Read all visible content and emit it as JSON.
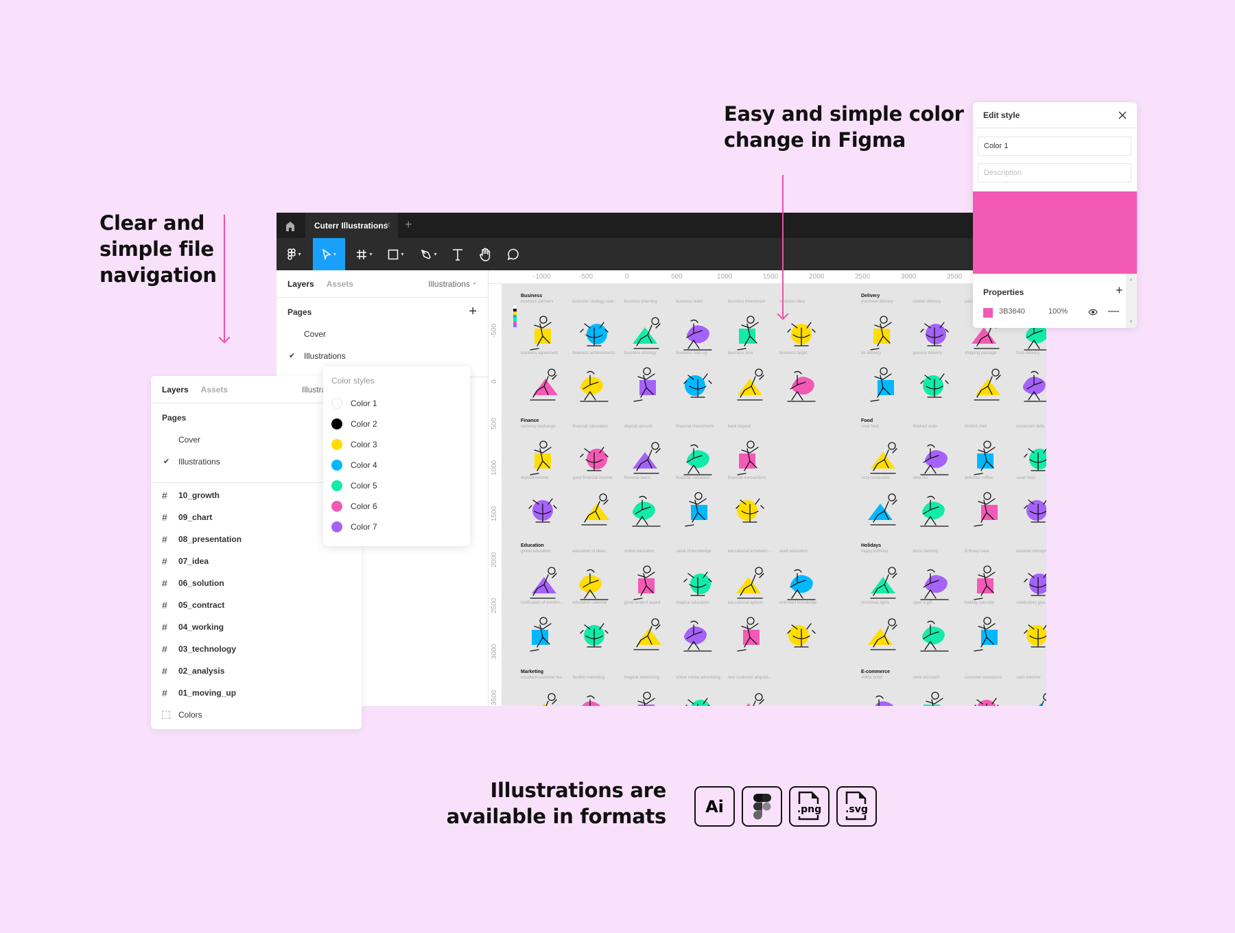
{
  "headlines": {
    "navigation": [
      "Clear and",
      "simple file",
      "navigation"
    ],
    "color_change": [
      "Easy and simple color",
      "change in Figma"
    ],
    "formats": [
      "Illustrations are",
      "available in formats"
    ]
  },
  "formats": [
    {
      "icon": "adobe-illustrator-icon",
      "label": "Ai"
    },
    {
      "icon": "figma-icon",
      "label": ""
    },
    {
      "icon": "png-file-icon",
      "label": ".png"
    },
    {
      "icon": "svg-file-icon",
      "label": ".svg"
    }
  ],
  "colors": {
    "background": "#f9e1fc",
    "accent_arrow": "#ef4fa6",
    "active_tool": "#18a0fb",
    "palette": {
      "white": "#ffffff",
      "black": "#000000",
      "yellow": "#ffdd00",
      "blue": "#00b8ff",
      "green": "#13eba8",
      "pink": "#f25ab5",
      "purple": "#a562f8"
    }
  },
  "window": {
    "tab_title": "Cuterr Illustrations",
    "tools": [
      "figma-menu",
      "move",
      "frame",
      "rectangle",
      "pen",
      "text",
      "hand",
      "comment"
    ],
    "panel": {
      "tab_layers": "Layers",
      "tab_assets": "Assets",
      "page_selector": "Illustrations",
      "pages_title": "Pages",
      "pages": [
        {
          "label": "Cover",
          "selected": false
        },
        {
          "label": "Illustrations",
          "selected": true
        }
      ]
    },
    "ruler_h": [
      "-1000",
      "-500",
      "0",
      "500",
      "1000",
      "1500",
      "2000",
      "2500",
      "3000",
      "3500"
    ],
    "ruler_v": [
      "-500",
      "0",
      "500",
      "1000",
      "1500",
      "2000",
      "2500",
      "3000",
      "3500"
    ]
  },
  "front_panel": {
    "tab_layers": "Layers",
    "tab_assets": "Assets",
    "page_selector": "Illustra",
    "pages_title": "Pages",
    "pages": [
      {
        "label": "Cover",
        "selected": false
      },
      {
        "label": "Illustrations",
        "selected": true
      }
    ],
    "layers": [
      "10_growth",
      "09_chart",
      "08_presentation",
      "07_idea",
      "06_solution",
      "05_contract",
      "04_working",
      "03_technology",
      "02_analysis",
      "01_moving_up"
    ],
    "component": "Colors"
  },
  "color_styles": {
    "title": "Color styles",
    "items": [
      {
        "label": "Color 1",
        "color": "#ffffff"
      },
      {
        "label": "Color 2",
        "color": "#000000"
      },
      {
        "label": "Color 3",
        "color": "#ffdd00"
      },
      {
        "label": "Color 4",
        "color": "#00b8ff"
      },
      {
        "label": "Color 5",
        "color": "#13eba8"
      },
      {
        "label": "Color 6",
        "color": "#f25ab5"
      },
      {
        "label": "Color 7",
        "color": "#a562f8"
      }
    ]
  },
  "edit_style": {
    "title": "Edit style",
    "name_value": "Color 1",
    "description_placeholder": "Description",
    "swatch_color": "#f25ab5",
    "properties_title": "Properties",
    "hex": "3B3640",
    "opacity": "100%"
  },
  "canvas": {
    "sections": [
      {
        "title": "Business",
        "group": 0,
        "row": 0,
        "rows": [
          [
            [
              "business partners",
              "yellow"
            ],
            [
              "business strategy sear...",
              "blue"
            ],
            [
              "business planning",
              "green"
            ],
            [
              "business team",
              "purple"
            ],
            [
              "business investment",
              "green"
            ],
            [
              "business idea",
              "yellow"
            ]
          ],
          [
            [
              "business agreement",
              "pink"
            ],
            [
              "business achievements",
              "yellow"
            ],
            [
              "business strategy",
              "purple"
            ],
            [
              "business start-up",
              "blue"
            ],
            [
              "business time",
              "yellow"
            ],
            [
              "business target",
              "pink"
            ]
          ]
        ]
      },
      {
        "title": "Delivery",
        "group": 1,
        "row": 0,
        "rows": [
          [
            [
              "purchase delivery",
              "yellow"
            ],
            [
              "courier delivery",
              "purple"
            ],
            [
              "parc",
              "pink"
            ],
            [
              "",
              "green"
            ]
          ],
          [
            [
              "air delivery",
              "blue"
            ],
            [
              "grocery delivery",
              "green"
            ],
            [
              "shipping package",
              "yellow"
            ],
            [
              "food delivery",
              "purple"
            ]
          ]
        ]
      },
      {
        "title": "Finance",
        "group": 0,
        "row": 1,
        "rows": [
          [
            [
              "currency exchange",
              "yellow"
            ],
            [
              "financial calculation",
              "pink"
            ],
            [
              "deposit amount",
              "purple"
            ],
            [
              "financial investments",
              "green"
            ],
            [
              "bank deposit",
              "pink"
            ]
          ],
          [
            [
              "deposit income",
              "purple"
            ],
            [
              "good financial income",
              "yellow"
            ],
            [
              "financial loans",
              "green"
            ],
            [
              "financial calculator",
              "blue"
            ],
            [
              "financial transactions",
              "yellow"
            ]
          ]
        ]
      },
      {
        "title": "Food",
        "group": 1,
        "row": 1,
        "rows": [
          [
            [
              "cook food",
              "yellow"
            ],
            [
              "finished order",
              "purple"
            ],
            [
              "kitchen chef",
              "blue"
            ],
            [
              "restaurant deliv...",
              "green"
            ]
          ],
          [
            [
              "cozy restaurant",
              "blue"
            ],
            [
              "wine list",
              "green"
            ],
            [
              "delicious coffee",
              "pink"
            ],
            [
              "asian food",
              "purple"
            ]
          ]
        ]
      },
      {
        "title": "Education",
        "group": 0,
        "row": 2,
        "rows": [
          [
            [
              "global education",
              "purple"
            ],
            [
              "education of ideas",
              "yellow"
            ],
            [
              "online education",
              "pink"
            ],
            [
              "value of knowledge",
              "green"
            ],
            [
              "educational achievem...",
              "yellow"
            ],
            [
              "team education",
              "blue"
            ]
          ],
          [
            [
              "notification of enrollm...",
              "blue"
            ],
            [
              "education calendar",
              "green"
            ],
            [
              "good student award",
              "yellow"
            ],
            [
              "magical education",
              "purple"
            ],
            [
              "educational options",
              "pink"
            ],
            [
              "unlimited knowledge",
              "yellow"
            ]
          ]
        ]
      },
      {
        "title": "Holidays",
        "group": 1,
        "row": 2,
        "rows": [
          [
            [
              "happy birthday",
              "green"
            ],
            [
              "disco dancing",
              "purple"
            ],
            [
              "birthday cake",
              "pink"
            ],
            [
              "karaoke microph...",
              "purple"
            ]
          ],
          [
            [
              "christmas lights",
              "yellow"
            ],
            [
              "open a gift",
              "green"
            ],
            [
              "holiday calendar",
              "blue"
            ],
            [
              "celebratory glas...",
              "yellow"
            ]
          ]
        ]
      },
      {
        "title": "Marketing",
        "group": 0,
        "row": 3,
        "rows": [
          [
            [
              "excellent customer fee...",
              "yellow"
            ],
            [
              "flexible marketing",
              "pink"
            ],
            [
              "magical advertising",
              "purple"
            ],
            [
              "online media advertising",
              "green"
            ],
            [
              "new customer acquisit...",
              "pink"
            ]
          ]
        ]
      },
      {
        "title": "E-commerce",
        "group": 1,
        "row": 3,
        "rows": [
          [
            [
              "online order",
              "purple"
            ],
            [
              "store assistant",
              "green"
            ],
            [
              "customer assistance",
              "pink"
            ],
            [
              "cash voucher",
              "blue"
            ]
          ]
        ]
      }
    ]
  }
}
